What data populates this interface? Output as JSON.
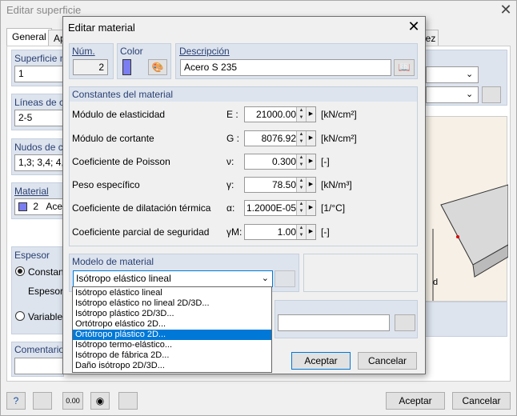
{
  "outer": {
    "title": "Editar superficie",
    "tabs": [
      "General",
      "Ap",
      "dez"
    ],
    "sections": {
      "superficie": "Superficie n",
      "superficie_val": "1",
      "lineas": "Líneas de co",
      "lineas_val": "2-5",
      "nudos": "Nudos de co",
      "nudos_val": "1,3; 3,4; 4,5",
      "material": "Material",
      "material_num": "2",
      "material_name": "Ace",
      "espesor": "Espesor",
      "constante": "Constante",
      "espesor_sub": "Espesor g",
      "variable": "Variable...",
      "comentario": "Comentario"
    },
    "ok_label": "Aceptar",
    "cancel_label": "Cancelar"
  },
  "dialog": {
    "title": "Editar material",
    "num_label": "Núm.",
    "num_value": "2",
    "color_label": "Color",
    "color_value": "#7b7ef0",
    "desc_label": "Descripción",
    "desc_value": "Acero S 235",
    "constants_header": "Constantes del material",
    "constants": [
      {
        "label": "Módulo de elasticidad",
        "sym": "E :",
        "value": "21000.00",
        "unit": "[kN/cm²]"
      },
      {
        "label": "Módulo de cortante",
        "sym": "G :",
        "value": "8076.92",
        "unit": "[kN/cm²]"
      },
      {
        "label": "Coeficiente de Poisson",
        "sym": "ν:",
        "value": "0.300",
        "unit": "[-]"
      },
      {
        "label": "Peso específico",
        "sym": "γ:",
        "value": "78.50",
        "unit": "[kN/m³]"
      },
      {
        "label": "Coeficiente de dilatación térmica",
        "sym": "α:",
        "value": "1.2000E-05",
        "unit": "[1/°C]"
      },
      {
        "label": "Coeficiente parcial de seguridad",
        "sym": "γM:",
        "value": "1.00",
        "unit": "[-]"
      }
    ],
    "model_header": "Modelo de material",
    "model_selected": "Isótropo elástico lineal",
    "model_options": [
      "Isótropo elástico lineal",
      "Isótropo elástico no lineal 2D/3D...",
      "Isótropo plástico 2D/3D...",
      "Ortótropo elástico 2D...",
      "Ortótropo plástico 2D...",
      "Isótropo termo-elástico...",
      "Isótropo de fábrica 2D...",
      "Daño isótropo 2D/3D..."
    ],
    "model_highlight_index": 4,
    "ok_label": "Aceptar",
    "cancel_label": "Cancelar"
  }
}
